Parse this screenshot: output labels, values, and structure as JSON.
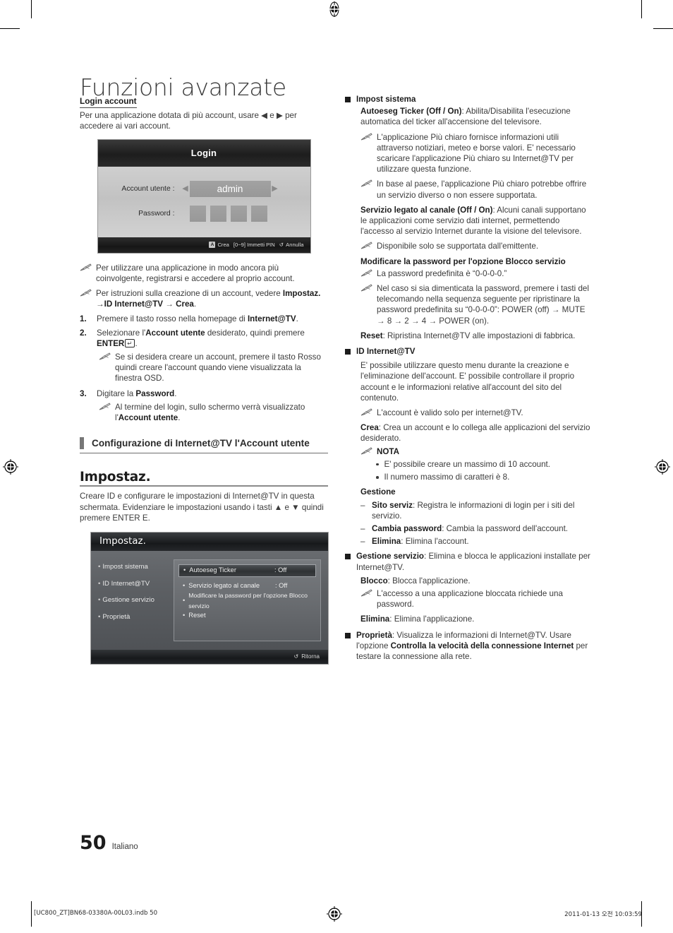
{
  "page": {
    "title": "Funzioni avanzate",
    "number": "50",
    "language": "Italiano"
  },
  "footer": {
    "left": "[UC800_ZT]BN68-03380A-00L03.indb   50",
    "right": "2011-01-13   오전 10:03:59"
  },
  "left_column": {
    "login_heading": "Login account",
    "login_intro": "Per una applicazione dotata di più account, usare ◀ e ▶ per accedere ai vari account.",
    "osd_login": {
      "title": "Login",
      "account_label": "Account utente :",
      "account_value": "admin",
      "password_label": "Password :",
      "password_dots": 4,
      "hint_red_key": "A",
      "hint_crea": "Crea",
      "hint_pin": "[0~9] Immetti PIN",
      "hint_return_icon": "↺",
      "hint_annulla": "Annulla"
    },
    "notes": [
      "Per utilizzare una applicazione in modo ancora più coinvolgente, registrarsi e accedere al proprio account."
    ],
    "note_instructions": {
      "prefix": "Per istruzioni sulla creazione di un account, vedere ",
      "bold1": "Impostaz.",
      "arrow1": " →",
      "bold2": "ID Internet@TV",
      "arrow2": " → ",
      "bold3": "Crea",
      "suffix": "."
    },
    "steps": [
      {
        "num": "1.",
        "parts": [
          {
            "t": "Premere il tasto rosso nella homepage di ",
            "b": false
          },
          {
            "t": "Internet@TV",
            "b": true
          },
          {
            "t": ".",
            "b": false
          }
        ]
      },
      {
        "num": "2.",
        "parts": [
          {
            "t": "Selezionare l'",
            "b": false
          },
          {
            "t": "Account utente",
            "b": true
          },
          {
            "t": " desiderato, quindi premere ",
            "b": false
          },
          {
            "t": "ENTER",
            "b": true
          },
          {
            "t": "E",
            "b": false
          },
          {
            "t": ".",
            "b": false
          }
        ],
        "note": "Se si desidera creare un account, premere il tasto Rosso quindi creare l'account quando viene visualizzata la finestra OSD."
      },
      {
        "num": "3.",
        "parts": [
          {
            "t": "Digitare la ",
            "b": false
          },
          {
            "t": "Password",
            "b": true
          },
          {
            "t": ".",
            "b": false
          }
        ],
        "note_parts": [
          {
            "t": "Al termine del login, sullo schermo verrà visualizzato l'",
            "b": false
          },
          {
            "t": "Account utente",
            "b": true
          },
          {
            "t": ".",
            "b": false
          }
        ]
      }
    ],
    "section_bar": "Configurazione di Internet@TV l'Account utente",
    "impostaz_heading": "Impostaz.",
    "impostaz_intro": "Creare ID e configurare le impostazioni di Internet@TV in questa schermata. Evidenziare le impostazioni usando i tasti ▲ e ▼ quindi premere ENTER E.",
    "osd_menu": {
      "title": "Impostaz.",
      "sidebar": [
        "Impost sistema",
        "ID Internet@TV",
        "Gestione servizio",
        "Proprietà"
      ],
      "items": [
        {
          "label": "Autoeseg Ticker",
          "value": ": Off",
          "selected": true
        },
        {
          "label": "Servizio legato al canale",
          "value": ": Off",
          "selected": false
        },
        {
          "label": "Modificare la password per l'opzione Blocco servizio",
          "value": "",
          "selected": false
        },
        {
          "label": "Reset",
          "value": "",
          "selected": false
        }
      ],
      "return_icon": "↺",
      "return_label": "Ritorna"
    }
  },
  "right_column": {
    "blocks": [
      {
        "heading": "Impost sistema",
        "para1_bold": "Autoeseg Ticker (Off / On)",
        "para1_rest": ": Abilita/Disabilita l'esecuzione automatica del ticker all'accensione del televisore.",
        "note1": "L'applicazione Più chiaro fornisce informazioni utili attraverso notiziari, meteo e borse valori. E' necessario scaricare l'applicazione Più chiaro su Internet@TV per utilizzare questa funzione.",
        "note2": "In base al paese, l'applicazione Più chiaro potrebbe offrire un servizio diverso o non essere supportata.",
        "para2_bold": "Servizio legato al canale (Off / On)",
        "para2_rest": ": Alcuni canali supportano le applicazioni come servizio dati internet, permettendo l'accesso al servizio Internet durante la visione del televisore.",
        "note3": "Disponibile solo se supportata dall'emittente.",
        "subheading": "Modificare la password per l'opzione Blocco servizio",
        "note4": "La password predefinita è “0-0-0-0.”",
        "note5": "Nel caso si sia dimenticata la password, premere i tasti del telecomando nella sequenza seguente per ripristinare la password predefinita su “0-0-0-0”: POWER (off) → MUTE → 8 → 2 → 4 → POWER (on).",
        "para3_bold": "Reset",
        "para3_rest": ": Ripristina Internet@TV alle impostazioni di fabbrica."
      },
      {
        "heading": "ID Internet@TV",
        "para1": "E' possibile utilizzare questo menu durante la creazione e l'eliminazione dell'account. E' possibile controllare il proprio account e le informazioni relative all'account del sito del contenuto.",
        "note1": "L'account è valido solo per internet@TV.",
        "para2_bold": "Crea",
        "para2_rest": ": Crea un account e lo collega alle applicazioni del servizio desiderato.",
        "nota_label": "NOTA",
        "nota_bullets": [
          "E' possibile creare un massimo di 10 account.",
          "Il numero massimo di caratteri è 8."
        ],
        "gestione_label": "Gestione",
        "gestione_items": [
          {
            "bold": "Sito serviz",
            "rest": ": Registra le informazioni di login per i siti del servizio."
          },
          {
            "bold": "Cambia password",
            "rest": ": Cambia la password dell'account."
          },
          {
            "bold": "Elimina",
            "rest": ": Elimina l'account."
          }
        ]
      },
      {
        "heading_bold": "Gestione servizio",
        "heading_rest": ": Elimina e blocca le applicazioni installate per Internet@TV.",
        "para1_bold": "Blocco",
        "para1_rest": ": Blocca l'applicazione.",
        "note1": "L'accesso a una applicazione bloccata richiede una password.",
        "para2_bold": "Elimina",
        "para2_rest": ": Elimina l'applicazione."
      },
      {
        "heading_bold": "Proprietà",
        "parts": [
          {
            "t": ": Visualizza le informazioni di Internet@TV. Usare l'opzione ",
            "b": false
          },
          {
            "t": "Controlla la velocità della connessione Internet",
            "b": true
          },
          {
            "t": " per testare la connessione alla rete.",
            "b": false
          }
        ]
      }
    ]
  }
}
